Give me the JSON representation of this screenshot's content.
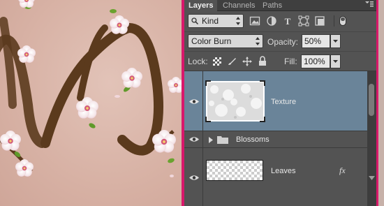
{
  "panel": {
    "tabs": [
      {
        "label": "Layers"
      },
      {
        "label": "Channels"
      },
      {
        "label": "Paths"
      }
    ],
    "filter": {
      "kind_label": "Kind"
    },
    "blend": {
      "mode": "Color Burn",
      "opacity_label": "Opacity:",
      "opacity_value": "50%"
    },
    "lock": {
      "label": "Lock:",
      "fill_label": "Fill:",
      "fill_value": "100%"
    },
    "layers": [
      {
        "name": "Texture",
        "selected": true,
        "visible": true
      },
      {
        "name": "Blossoms",
        "type": "group",
        "collapsed": true,
        "visible": true
      },
      {
        "name": "Leaves",
        "visible": true,
        "effects_badge": "fx"
      }
    ]
  },
  "colors": {
    "panel_bg": "#535353",
    "selection": "#6a8499",
    "accent_border": "#d9186b",
    "canvas_bg": "#d9b7ab",
    "branch": "#5b3a1d"
  },
  "icons": [
    "image-filter-icon",
    "adjustment-filter-icon",
    "type-filter-icon",
    "shape-filter-icon",
    "smart-object-filter-icon",
    "eye-icon",
    "folder-icon",
    "fx-icon"
  ]
}
